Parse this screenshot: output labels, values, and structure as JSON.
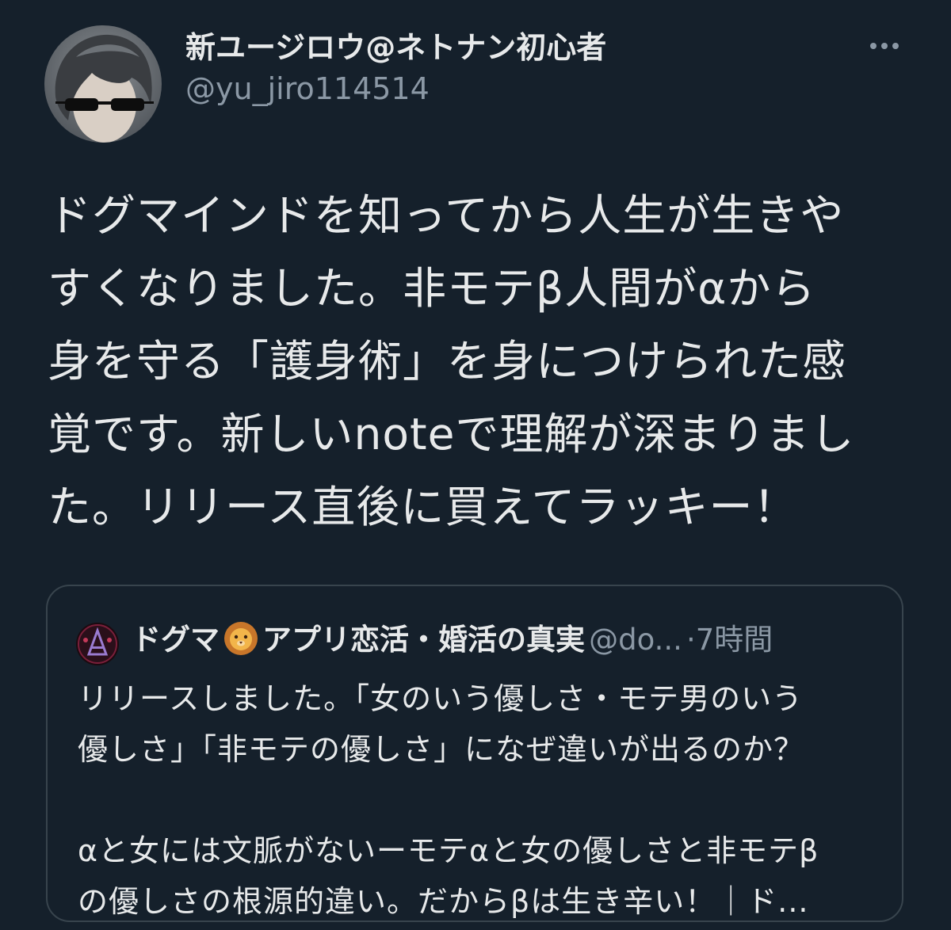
{
  "tweet": {
    "author": {
      "display_name": "新ユージロウ@ネトナン初心者",
      "handle": "@yu_jiro114514",
      "avatar_icon": "user-avatar"
    },
    "more_icon": "more-horizontal-icon",
    "text": "ドグマインドを知ってから人生が生きや\nすくなりました。非モテβ人間がαから\n身を守る「護身術」を身につけられた感\n覚です。新しいnoteで理解が深まりまし\nた。リリース直後に買えてラッキー！",
    "quoted_tweet": {
      "author_name_prefix": "ドグマ",
      "author_emoji_icon": "lion-face-icon",
      "author_name_suffix": "アプリ恋活・婚活の真実",
      "handle": "@do...",
      "separator": "·",
      "timestamp": "7時間",
      "text": "リリースしました。「女のいう優しさ・モテ男のいう\n優しさ」「非モテの優しさ」になぜ違いが出るのか？\n\nαと女には文脈がないーモテαと女の優しさと非モテβ\nの優しさの根源的違い。だからβは生き辛い！｜ド..."
    }
  },
  "colors": {
    "background": "#15202b",
    "text_primary": "#e7e9ea",
    "text_secondary": "#8b98a5",
    "border": "#38444d"
  }
}
